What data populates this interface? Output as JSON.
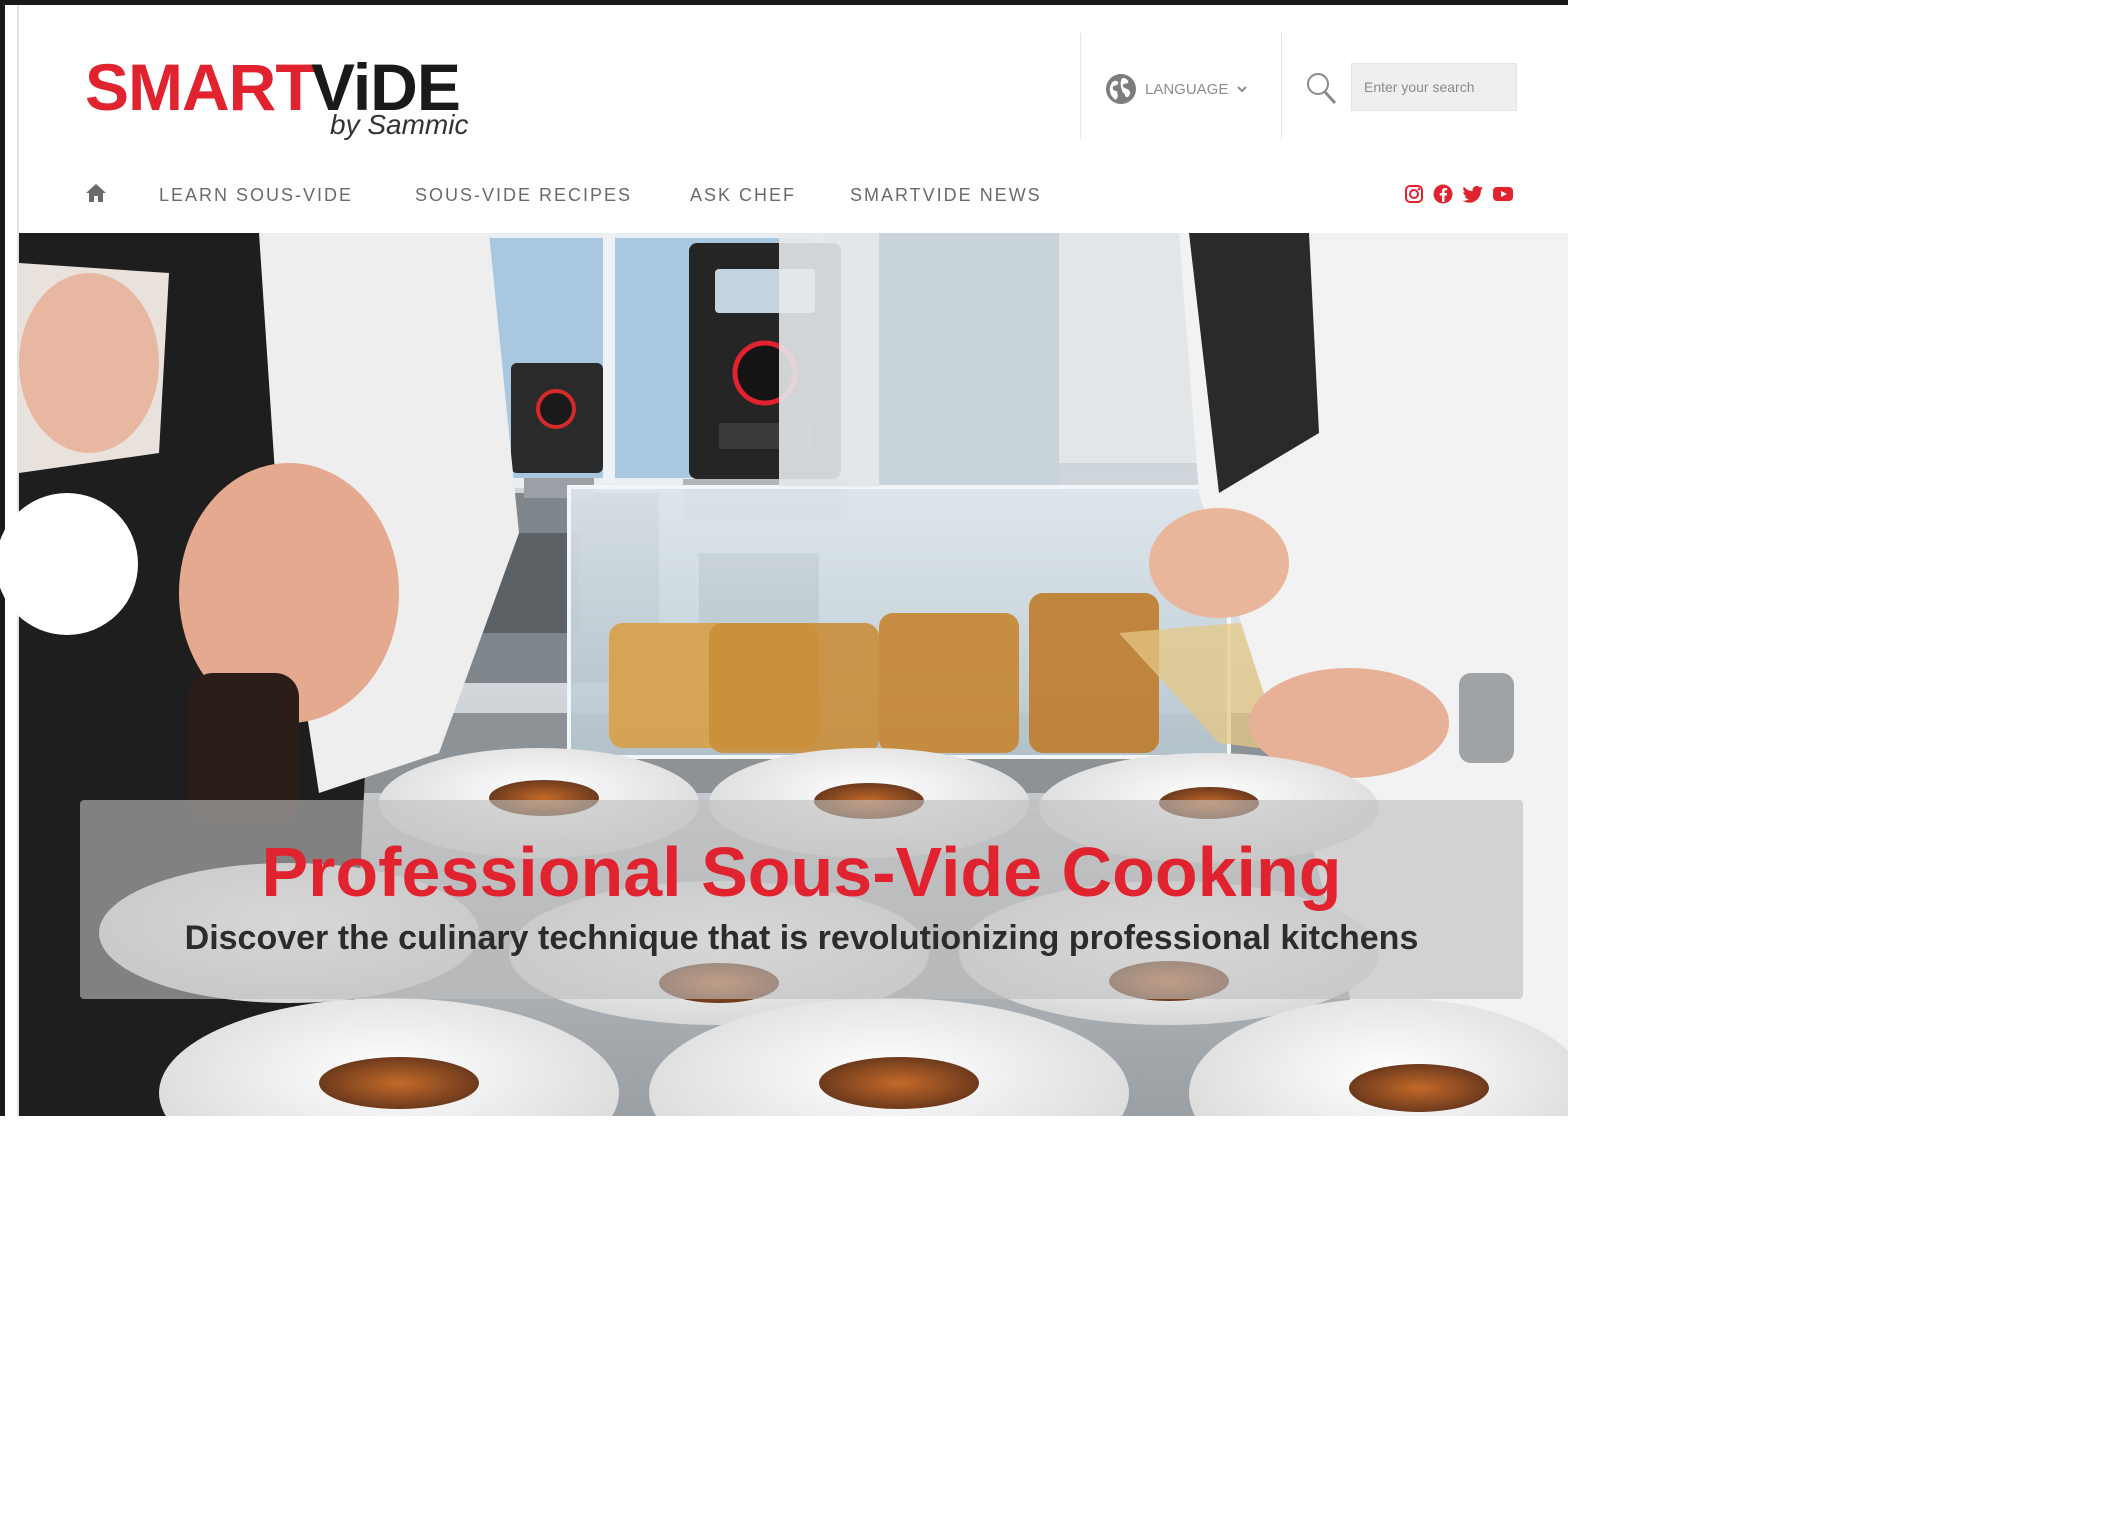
{
  "brand": {
    "name_part1": "SMART",
    "name_part2": "ViDE",
    "tagline": "by Sammic",
    "primary_color": "#e1222f"
  },
  "header": {
    "language_label": "LANGUAGE",
    "search_placeholder": "Enter your search"
  },
  "nav": {
    "home_icon": "home-icon",
    "items": [
      {
        "label": "LEARN SOUS-VIDE"
      },
      {
        "label": "SOUS-VIDE RECIPES"
      },
      {
        "label": "ASK CHEF"
      },
      {
        "label": "SMARTVIDE NEWS"
      }
    ],
    "social": [
      "instagram-icon",
      "facebook-icon",
      "twitter-icon",
      "youtube-icon"
    ]
  },
  "hero": {
    "title": "Professional Sous-Vide Cooking",
    "subtitle": "Discover the culinary technique that is revolutionizing professional kitchens"
  }
}
